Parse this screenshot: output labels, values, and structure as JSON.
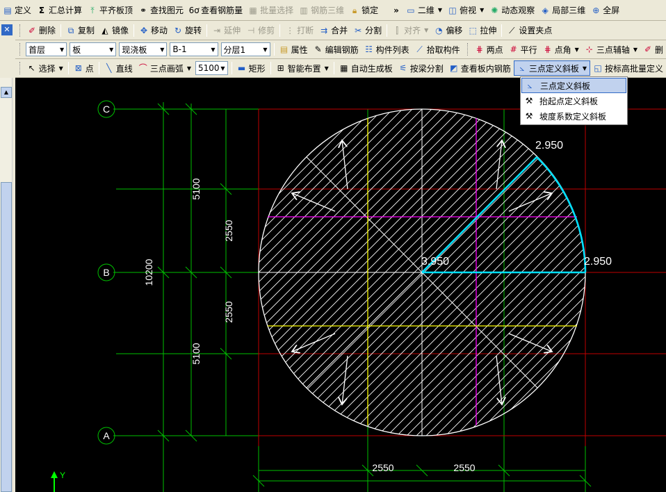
{
  "toolbar1": {
    "items": [
      {
        "label": "定义",
        "icon": "define-icon"
      },
      {
        "label": "汇总计算",
        "icon": "sigma-icon"
      },
      {
        "label": "平齐板顶",
        "icon": "align-top-icon"
      },
      {
        "label": "查找图元",
        "icon": "binoculars-icon"
      },
      {
        "label": "查看钢筋量",
        "icon": "rebar-view-icon"
      },
      {
        "label": "批量选择",
        "icon": "batch-select-icon"
      },
      {
        "label": "钢筋三维",
        "icon": "rebar-3d-icon"
      },
      {
        "label": "锁定",
        "icon": "lock-icon"
      }
    ],
    "overflow": "»",
    "view2d": "二维",
    "topview": "俯视",
    "dynamic": "动态观察",
    "local3d": "局部三维",
    "fullscreen": "全屏"
  },
  "toolbar2": {
    "items": [
      {
        "label": "删除",
        "disabled": false
      },
      {
        "label": "复制",
        "disabled": false
      },
      {
        "label": "镜像",
        "disabled": false
      },
      {
        "label": "移动",
        "disabled": false
      },
      {
        "label": "旋转",
        "disabled": false
      },
      {
        "label": "延伸",
        "disabled": true
      },
      {
        "label": "修剪",
        "disabled": true
      },
      {
        "label": "打断",
        "disabled": true
      },
      {
        "label": "合并",
        "disabled": false
      },
      {
        "label": "分割",
        "disabled": false
      },
      {
        "label": "对齐",
        "disabled": true
      },
      {
        "label": "偏移",
        "disabled": false
      },
      {
        "label": "拉伸",
        "disabled": false
      },
      {
        "label": "设置夹点",
        "disabled": false
      }
    ]
  },
  "toolbar3": {
    "floor": "首层",
    "category": "板",
    "type": "现浇板",
    "component": "B-1",
    "sublayer": "分层1",
    "items": [
      "属性",
      "编辑钢筋",
      "构件列表",
      "拾取构件",
      "两点",
      "平行",
      "点角",
      "三点辅轴",
      "删"
    ]
  },
  "toolbar4": {
    "select": "选择",
    "point": "点",
    "line": "直线",
    "arc": "三点画弧",
    "arc_value": "5100",
    "rect": "矩形",
    "smart": "智能布置",
    "auto_gen": "自动生成板",
    "beam_split": "按梁分割",
    "view_rebar": "查看板内钢筋",
    "three_point_slope": "三点定义斜板",
    "batch_elev": "按标高批量定义"
  },
  "dropdown": {
    "items": [
      "三点定义斜板",
      "抬起点定义斜板",
      "坡度系数定义斜板"
    ]
  },
  "drawing": {
    "axes": [
      "C",
      "B",
      "A"
    ],
    "dims_outer": [
      "5100",
      "5100"
    ],
    "dim_total": "10200",
    "dims_inner": [
      "2550",
      "2550"
    ],
    "dims_bottom": [
      "2550",
      "2550"
    ],
    "elevations": [
      "2.950",
      "3.950",
      "2.950"
    ],
    "ucs_y": "Y"
  },
  "colors": {
    "grid": "#00C000",
    "axis_red": "#C00000",
    "magenta": "#FF00FF",
    "yellow": "#FFFF00",
    "cyan": "#00E0FF",
    "white": "#FFFFFF"
  }
}
